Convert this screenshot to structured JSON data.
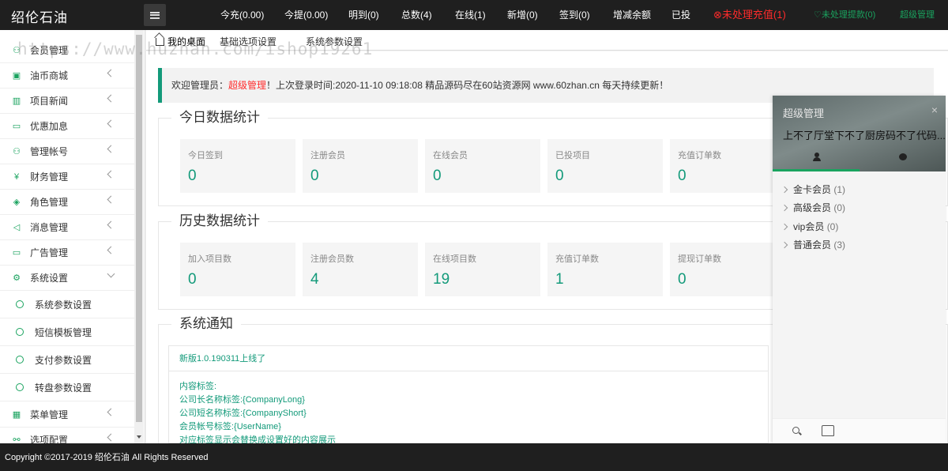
{
  "app": {
    "brand": "绍伦石油"
  },
  "topnav": [
    {
      "label": "今充(0.00)"
    },
    {
      "label": "今提(0.00)"
    },
    {
      "label": "明到(0)"
    },
    {
      "label": "总数(4)"
    },
    {
      "label": "在线(1)"
    },
    {
      "label": "新增(0)"
    },
    {
      "label": "签到(0)"
    },
    {
      "label": "增减余额"
    },
    {
      "label": "已投"
    },
    {
      "label": "未处理充值(1)"
    },
    {
      "label": "未处理提款(0)"
    },
    {
      "label": "超级管理"
    }
  ],
  "sidebar": {
    "items": [
      {
        "label": "会员管理",
        "icon": "user-icon"
      },
      {
        "label": "油币商城",
        "icon": "shop-icon"
      },
      {
        "label": "项目新闻",
        "icon": "news-icon"
      },
      {
        "label": "优惠加息",
        "icon": "image-icon"
      },
      {
        "label": "管理帐号",
        "icon": "account-icon"
      },
      {
        "label": "财务管理",
        "icon": "yen-icon"
      },
      {
        "label": "角色管理",
        "icon": "shield-icon"
      },
      {
        "label": "消息管理",
        "icon": "sound-icon"
      },
      {
        "label": "广告管理",
        "icon": "ad-icon"
      },
      {
        "label": "系统设置",
        "icon": "gear-icon"
      }
    ],
    "sub_items": [
      {
        "label": "系统参数设置"
      },
      {
        "label": "短信模板管理"
      },
      {
        "label": "支付参数设置"
      },
      {
        "label": "转盘参数设置"
      }
    ],
    "tail_items": [
      {
        "label": "菜单管理",
        "icon": "menu-icon"
      },
      {
        "label": "选项配置",
        "icon": "options-icon"
      }
    ]
  },
  "tabs": [
    {
      "label": "我的桌面"
    },
    {
      "label": "基础选项设置"
    },
    {
      "label": "系统参数设置"
    }
  ],
  "welcome": {
    "prefix": "欢迎管理员：",
    "name": "超级管理",
    "suffix": "！上次登录时间:2020-11-10 09:18:08 精品源码尽在60站资源网 www.60zhan.cn 每天持续更新！"
  },
  "today": {
    "title": "今日数据统计",
    "stats": [
      {
        "label": "今日签到",
        "value": "0"
      },
      {
        "label": "注册会员",
        "value": "0"
      },
      {
        "label": "在线会员",
        "value": "0"
      },
      {
        "label": "已投项目",
        "value": "0"
      },
      {
        "label": "充值订单数",
        "value": "0"
      }
    ]
  },
  "history": {
    "title": "历史数据统计",
    "stats": [
      {
        "label": "加入项目数",
        "value": "0"
      },
      {
        "label": "注册会员数",
        "value": "4"
      },
      {
        "label": "在线项目数",
        "value": "19"
      },
      {
        "label": "充值订单数",
        "value": "1"
      },
      {
        "label": "提现订单数",
        "value": "0"
      }
    ]
  },
  "notice": {
    "title": "系统通知",
    "head": "新版1.0.190311上线了",
    "lines": [
      "内容标签:",
      "公司长名称标签:{CompanyLong}",
      "公司短名称标签:{CompanyShort}",
      "会员帐号标签:{UserName}",
      "对应标签显示会替换成设置好的内容展示"
    ]
  },
  "chat_panel": {
    "title": "超级管理",
    "close": "×",
    "signature": "上不了厅堂下不了厨房码不了代码...",
    "groups": [
      {
        "name": "金卡会员",
        "count": "(1)"
      },
      {
        "name": "高级会员",
        "count": "(0)"
      },
      {
        "name": "vip会员",
        "count": "(0)"
      },
      {
        "name": "普通会员",
        "count": "(3)"
      }
    ]
  },
  "footer": {
    "text": "Copyright ©2017-2019 绍伦石油 All Rights Reserved"
  },
  "watermark": "https://www.huzhan.com/ishop19261",
  "colors": {
    "accent": "#139a7a",
    "alert": "#ff2b2b",
    "topbar": "#1f1f1f"
  }
}
